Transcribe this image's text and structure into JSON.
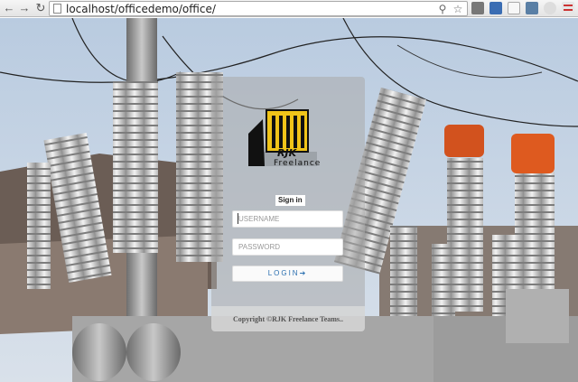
{
  "browser": {
    "url": "localhost/officedemo/office/",
    "back_icon": "back-arrow-icon",
    "forward_icon": "forward-arrow-icon",
    "reload_icon": "reload-icon"
  },
  "logo": {
    "brand": "RJK",
    "subtitle": "Freelance"
  },
  "form": {
    "title": "Sign in",
    "username_placeholder": "USERNAME",
    "password_placeholder": "PASSWORD",
    "login_label": "LOGIN"
  },
  "footer": {
    "text": "Copyright ©RJK Freelance Teams.."
  },
  "colors": {
    "accent": "#2a6fb0",
    "logo_yellow": "#f0c419"
  }
}
